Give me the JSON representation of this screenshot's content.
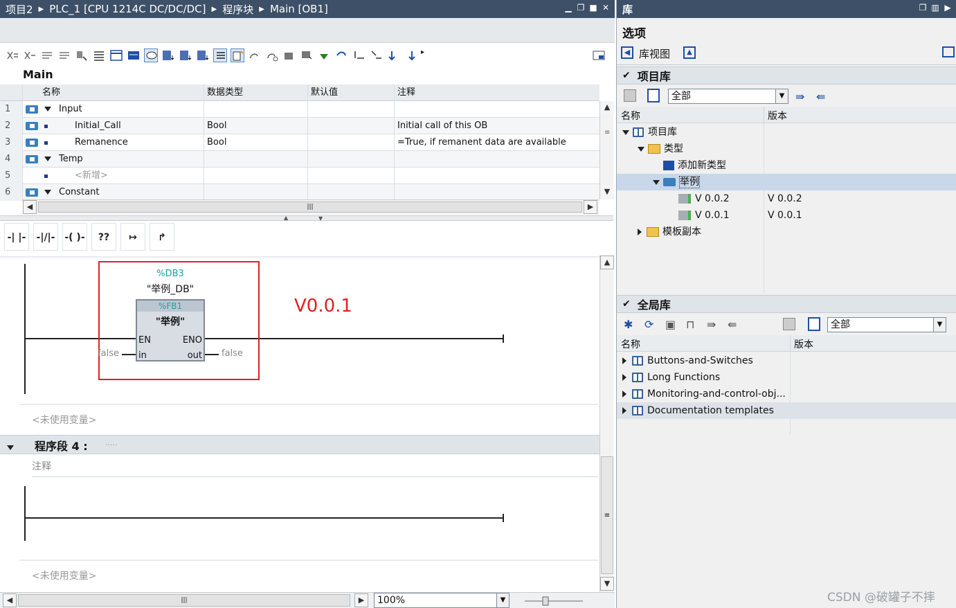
{
  "editor": {
    "breadcrumb": [
      "项目2",
      "PLC_1 [CPU 1214C DC/DC/DC]",
      "程序块",
      "Main [OB1]"
    ],
    "block_title": "Main",
    "columns": [
      "名称",
      "数据类型",
      "默认值",
      "注释"
    ],
    "rows": [
      {
        "num": "1",
        "name": "Input",
        "type": "",
        "default": "",
        "comment": "",
        "kind": "section"
      },
      {
        "num": "2",
        "name": "Initial_Call",
        "type": "Bool",
        "default": "",
        "comment": "Initial call of this OB",
        "kind": "var"
      },
      {
        "num": "3",
        "name": "Remanence",
        "type": "Bool",
        "default": "",
        "comment": "=True, if remanent data are available",
        "kind": "var"
      },
      {
        "num": "4",
        "name": "Temp",
        "type": "",
        "default": "",
        "comment": "",
        "kind": "section"
      },
      {
        "num": "5",
        "name": "<新增>",
        "type": "",
        "default": "",
        "comment": "",
        "kind": "add"
      },
      {
        "num": "6",
        "name": "Constant",
        "type": "",
        "default": "",
        "comment": "",
        "kind": "section"
      }
    ],
    "ladder_buttons": [
      "-| |-",
      "-|/|-",
      "-( )-",
      "??",
      "↦",
      "↱"
    ],
    "network3": {
      "db_address": "%DB3",
      "db_name": "\"举例_DB\"",
      "fb_address": "%FB1",
      "fb_name": "\"举例\"",
      "pin_en": "EN",
      "pin_eno": "ENO",
      "pin_in": "in",
      "pin_out": "out",
      "in_value": "false",
      "out_value": "false",
      "annotation": "V0.0.1",
      "unused_vars": "<未使用变量>"
    },
    "network4": {
      "title": "程序段 4 :",
      "title_dots": ".....",
      "comment": "注释",
      "unused_vars": "<未使用变量>"
    },
    "zoom": "100%"
  },
  "library": {
    "title": "库",
    "options_label": "选项",
    "library_view": "库视图",
    "project_lib": {
      "title": "项目库",
      "filter": "全部",
      "col_name": "名称",
      "col_version": "版本",
      "tree": [
        {
          "label": "项目库",
          "version": "",
          "level": 0,
          "expanded": true,
          "icon": "book-icon"
        },
        {
          "label": "类型",
          "version": "",
          "level": 1,
          "expanded": true,
          "icon": "folder-icon"
        },
        {
          "label": "添加新类型",
          "version": "",
          "level": 2,
          "expanded": null,
          "icon": "new-type-icon"
        },
        {
          "label": "举例",
          "version": "",
          "level": 2,
          "expanded": true,
          "icon": "fb-type-icon",
          "selected": true
        },
        {
          "label": "V 0.0.2",
          "version": "V 0.0.2",
          "level": 3,
          "expanded": null,
          "icon": "version-icon"
        },
        {
          "label": "V 0.0.1",
          "version": "V 0.0.1",
          "level": 3,
          "expanded": null,
          "icon": "version-icon"
        },
        {
          "label": "模板副本",
          "version": "",
          "level": 1,
          "expanded": false,
          "icon": "folder-icon"
        }
      ]
    },
    "global_lib": {
      "title": "全局库",
      "filter": "全部",
      "col_name": "名称",
      "col_version": "版本",
      "items": [
        "Buttons-and-Switches",
        "Long Functions",
        "Monitoring-and-control-obj...",
        "Documentation templates"
      ]
    },
    "watermark": "CSDN @破罐子不摔"
  },
  "colors": {
    "titlebar": "#3d5068",
    "annotation_red": "#e02020",
    "address_teal": "#1ba0a0",
    "selection": "#c9d7ea"
  }
}
